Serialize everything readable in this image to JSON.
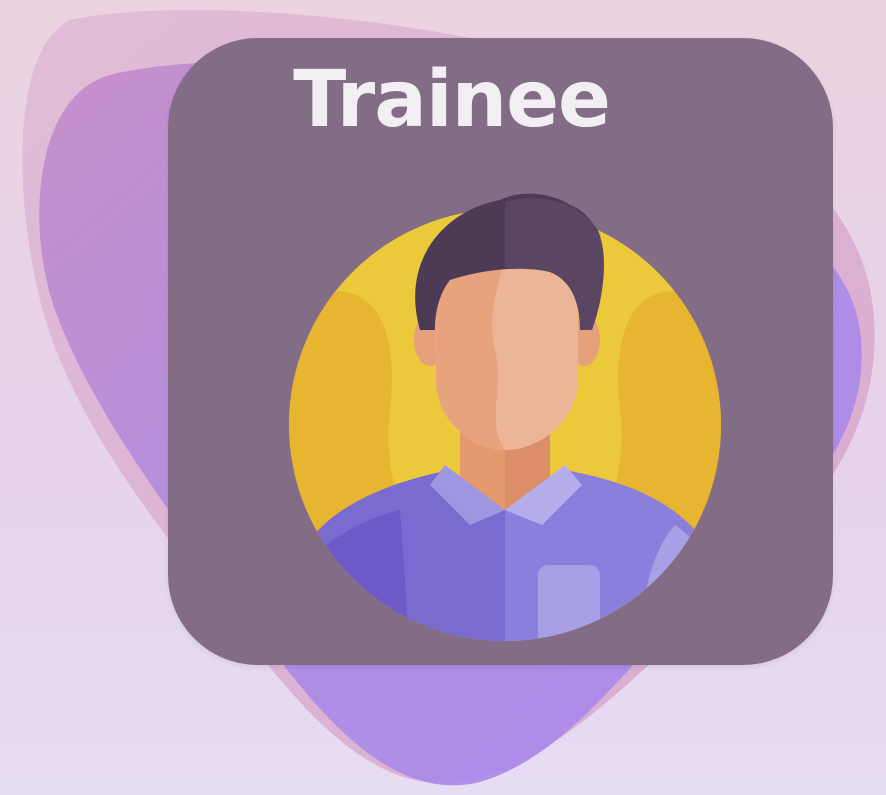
{
  "role_card": {
    "title": "Trainee",
    "avatar_icon": "male-user-avatar-icon"
  },
  "colors": {
    "card_background": "#836c86",
    "title_text": "#f1eff1",
    "blob_primary": "#a98be6",
    "blob_secondary": "#c98fc9",
    "avatar_circle": "#ecc93a",
    "shirt": "#8a7fdc",
    "hair": "#4d3a55",
    "skin": "#ecb597"
  }
}
